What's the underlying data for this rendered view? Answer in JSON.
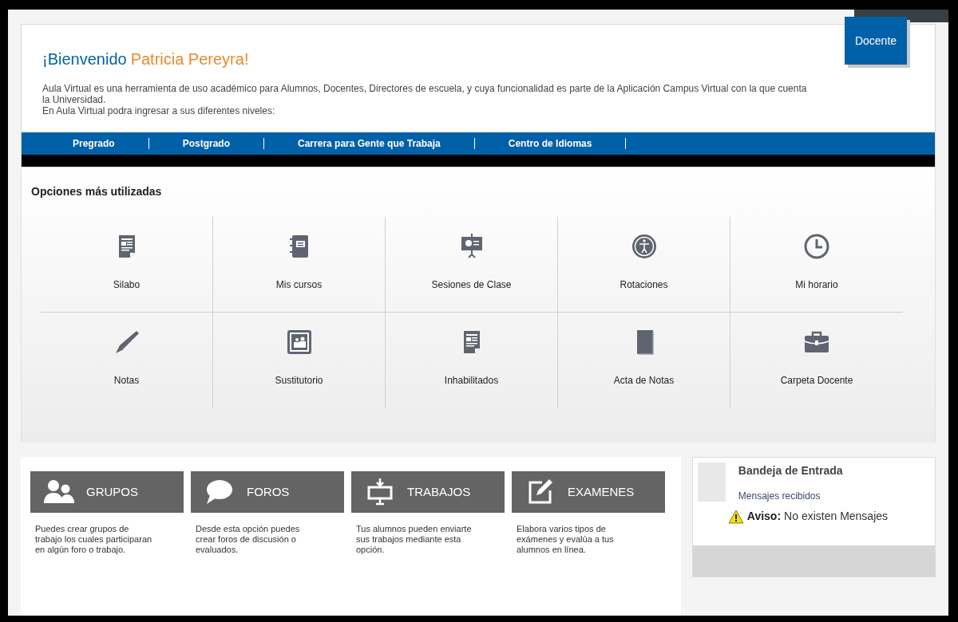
{
  "header": {
    "greeting": "¡Bienvenido",
    "user_name": "Patricia Pereyra!",
    "role_badge": "Docente",
    "intro_lines": [
      "Aula Virtual es una herramienta de uso académico para Alumnos, Docentes, Directores de escuela, y cuya funcionalidad es parte de la Aplicación Campus Virtual con la que cuenta la Universidad.",
      "En Aula Virtual podra ingresar a sus diferentes niveles:"
    ]
  },
  "levels_nav": [
    "Pregrado",
    "Postgrado",
    "Carrera para Gente que Trabaja",
    "Centro de Idiomas"
  ],
  "options": {
    "title": "Opciones más utilizadas",
    "items": [
      {
        "label": "Silabo",
        "kind": "document"
      },
      {
        "label": "Mis cursos",
        "kind": "notebook"
      },
      {
        "label": "Sesiones de Clase",
        "kind": "presentation"
      },
      {
        "label": "Rotaciones",
        "kind": "person"
      },
      {
        "label": "Mi horario",
        "kind": "clock"
      },
      {
        "label": "Notas",
        "kind": "pen"
      },
      {
        "label": "Sustitutorio",
        "kind": "group"
      },
      {
        "label": "Inhabilitados",
        "kind": "document"
      },
      {
        "label": "Acta de Notas",
        "kind": "book"
      },
      {
        "label": "Carpeta Docente",
        "kind": "briefcase"
      }
    ]
  },
  "features": [
    {
      "title": "GRUPOS",
      "kind": "people",
      "description": "Puedes crear grupos de trabajo los cuales participaran en algún foro o trabajo."
    },
    {
      "title": "FOROS",
      "kind": "speech",
      "description": "Desde esta opción puedes crear foros de discusión o evaluados."
    },
    {
      "title": "TRABAJOS",
      "kind": "upload",
      "description": "Tus alumnos pueden enviarte sus trabajos mediante esta opción."
    },
    {
      "title": "EXAMENES",
      "kind": "edit",
      "description": "Elabora varios tipos de exámenes y evalúa a tus alumnos en línea."
    }
  ],
  "inbox": {
    "title": "Bandeja de Entrada",
    "subtitle": "Mensajes recibidos",
    "notice_label": "Aviso:",
    "notice_text": "No existen Mensajes"
  }
}
